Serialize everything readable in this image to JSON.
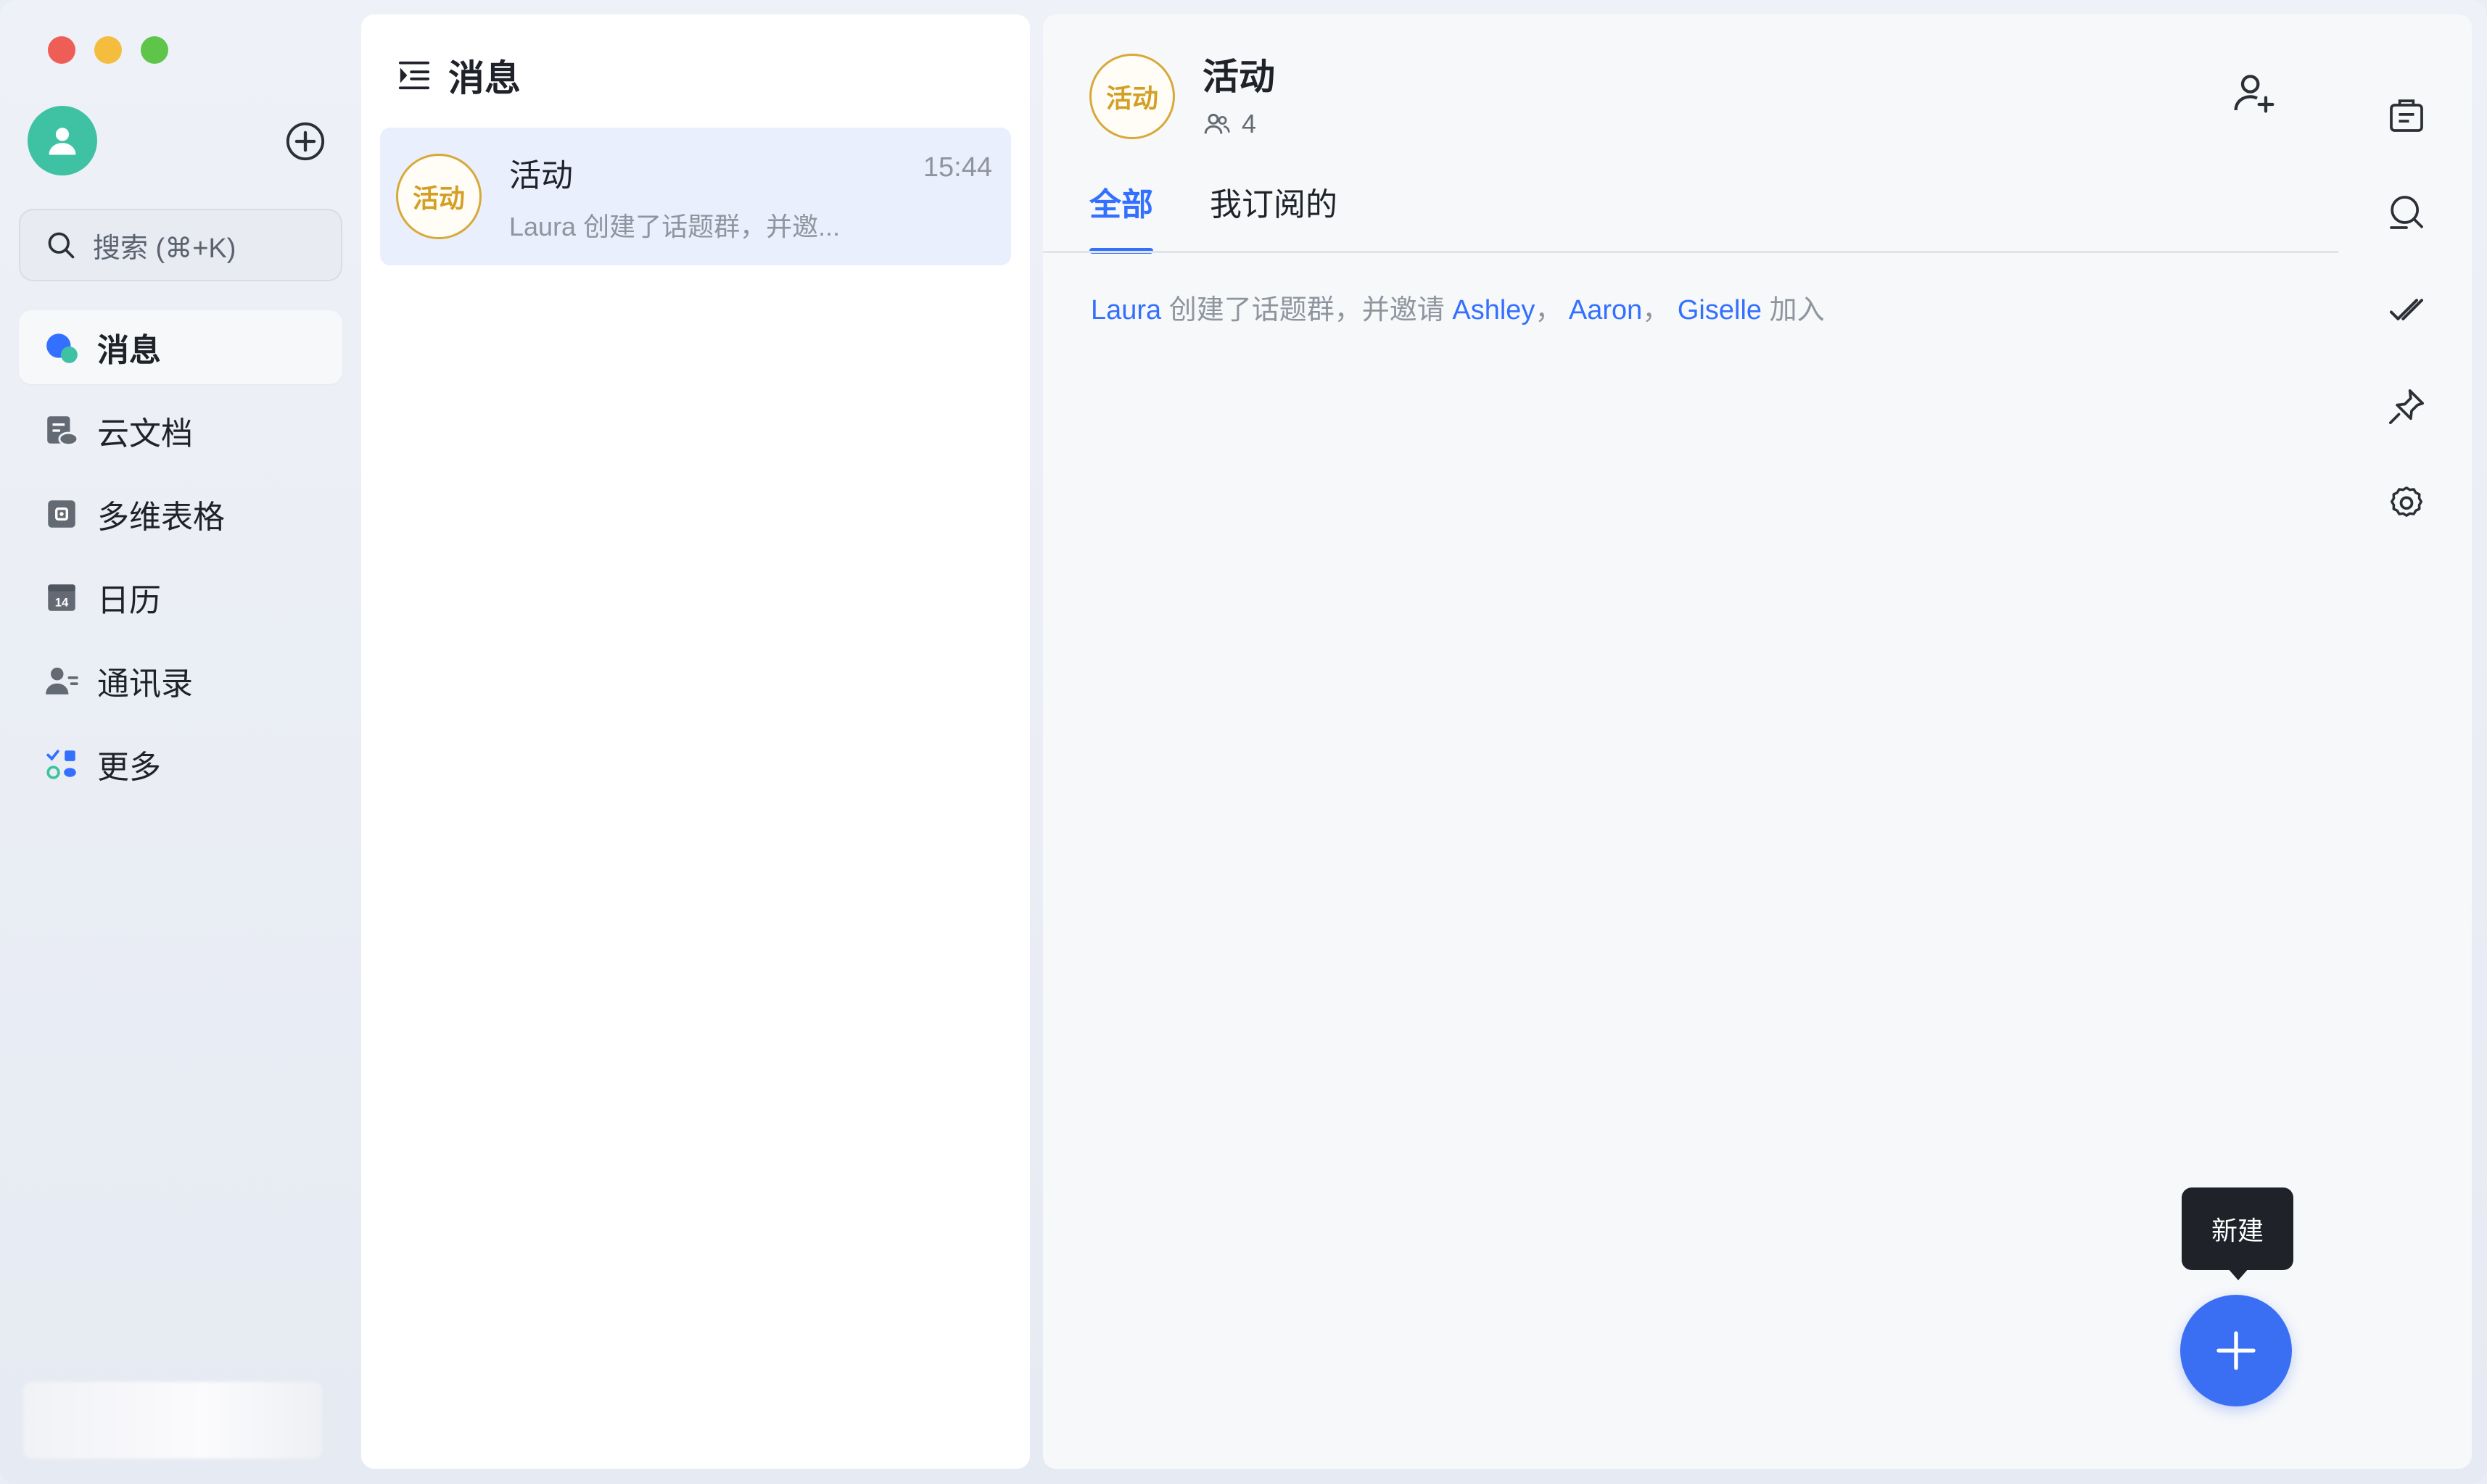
{
  "window": {
    "traffic_lights": [
      "#ee5e57",
      "#f4bd3e",
      "#5fc54a"
    ]
  },
  "sidebar": {
    "search_placeholder": "搜索 (⌘+K)",
    "items": [
      {
        "label": "消息",
        "icon": "message-icon",
        "active": true
      },
      {
        "label": "云文档",
        "icon": "cloud-doc-icon",
        "active": false
      },
      {
        "label": "多维表格",
        "icon": "base-table-icon",
        "active": false
      },
      {
        "label": "日历",
        "icon": "calendar-icon",
        "active": false
      },
      {
        "label": "通讯录",
        "icon": "contacts-icon",
        "active": false
      },
      {
        "label": "更多",
        "icon": "more-apps-icon",
        "active": false
      }
    ],
    "calendar_day": "14"
  },
  "chat_list": {
    "title": "消息",
    "conversations": [
      {
        "avatar_text": "活动",
        "name": "活动",
        "time": "15:44",
        "preview": "Laura 创建了话题群，并邀..."
      }
    ]
  },
  "chat": {
    "avatar_text": "活动",
    "title": "活动",
    "member_count": "4",
    "tabs": [
      {
        "label": "全部",
        "active": true
      },
      {
        "label": "我订阅的",
        "active": false
      }
    ],
    "system_message": {
      "actor": "Laura",
      "action": "创建了话题群，并邀请",
      "invitee1": "Ashley",
      "sep1": "，",
      "invitee2": "Aaron",
      "sep2": "，",
      "invitee3": "Giselle",
      "suffix": "加入"
    },
    "tooltip": "新建"
  },
  "right_toolbar": [
    "board-icon",
    "search-icon",
    "done-check-icon",
    "pin-icon",
    "settings-icon"
  ],
  "colors": {
    "accent": "#3370ff",
    "badge_gold": "#d39f24",
    "avatar_green": "#3fc2a3"
  }
}
